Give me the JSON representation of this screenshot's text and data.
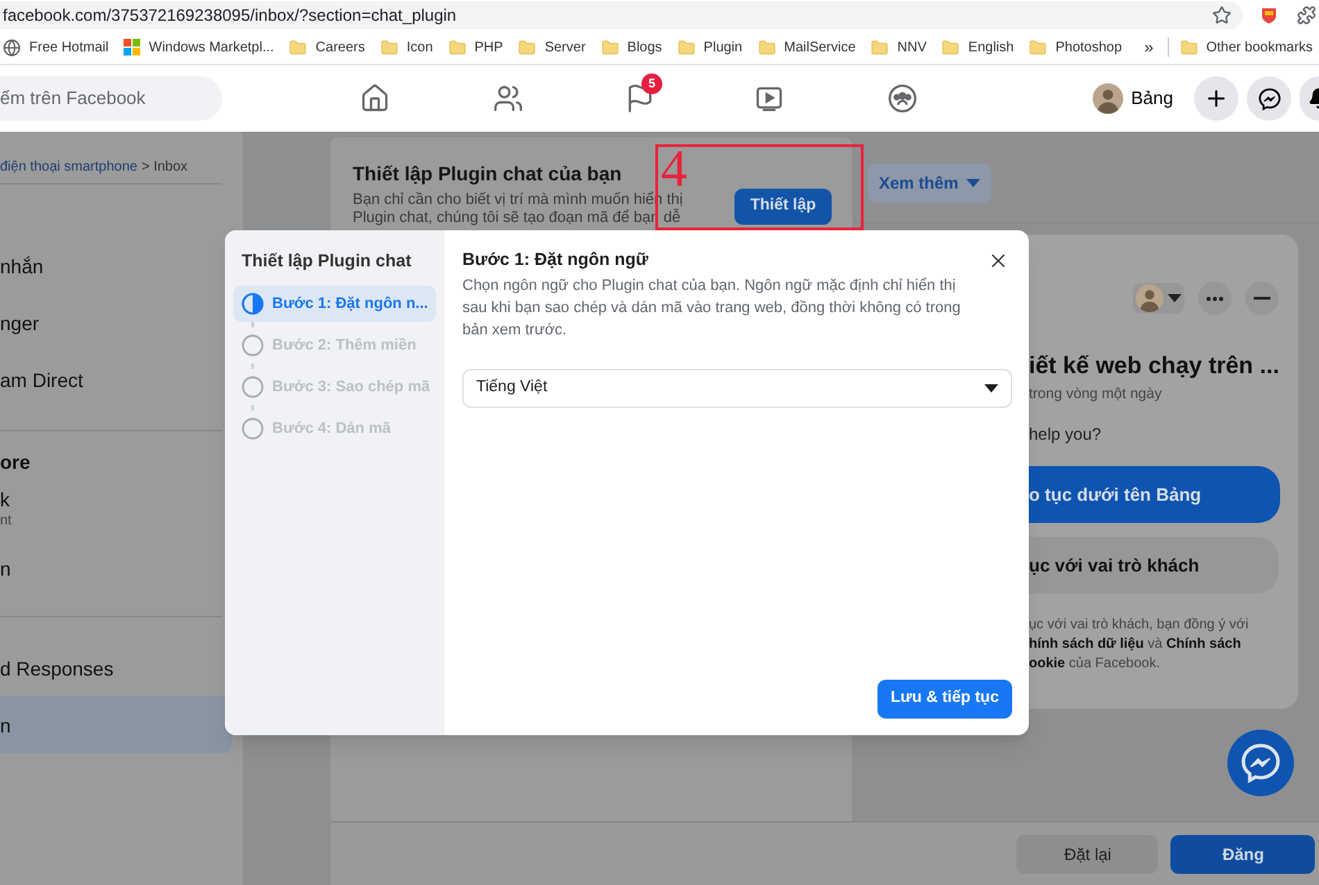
{
  "browser": {
    "url": "facebook.com/375372169238095/inbox/?section=chat_plugin",
    "bookmarks": [
      {
        "label": "Free Hotmail",
        "kind": "site"
      },
      {
        "label": "Windows Marketpl...",
        "kind": "windows"
      },
      {
        "label": "Careers",
        "kind": "folder"
      },
      {
        "label": "Icon",
        "kind": "folder"
      },
      {
        "label": "PHP",
        "kind": "folder"
      },
      {
        "label": "Server",
        "kind": "folder"
      },
      {
        "label": "Blogs",
        "kind": "folder"
      },
      {
        "label": "Plugin",
        "kind": "folder"
      },
      {
        "label": "MailService",
        "kind": "folder"
      },
      {
        "label": "NNV",
        "kind": "folder"
      },
      {
        "label": "English",
        "kind": "folder"
      },
      {
        "label": "Photoshop",
        "kind": "folder"
      }
    ],
    "overflow": "»",
    "other_bookmarks": "Other bookmarks"
  },
  "nav": {
    "search_placeholder": "ếm trên Facebook",
    "pages_badge": "5",
    "profile_name": "Bảng"
  },
  "breadcrumb": {
    "link": "điện thoại smartphone",
    "rest": "> Inbox"
  },
  "sidebar": {
    "groups": [
      {
        "items": [
          {
            "label": "nhắn",
            "selected": false
          },
          {
            "label": "nger",
            "selected": false
          },
          {
            "label": "am Direct",
            "selected": false
          }
        ]
      },
      {
        "heading": "ore",
        "items": [
          {
            "label": "k",
            "sublabel": "nt",
            "selected": false
          },
          {
            "label": "n",
            "selected": false
          }
        ]
      },
      {
        "items": [
          {
            "label": "d Responses",
            "selected": false
          },
          {
            "label": "n",
            "selected": true
          }
        ]
      }
    ]
  },
  "setup_card": {
    "title": "Thiết lập Plugin chat của bạn",
    "description": "Bạn chỉ cần cho biết vị trí mà mình muốn hiển thị Plugin chat, chúng tôi sẽ tạo đoạn mã để bạn dễ",
    "button": "Thiết lập"
  },
  "annotation": {
    "label": "4"
  },
  "more_button": "Xem thêm",
  "chat_preview": {
    "title": "iết kế web chạy trên ...",
    "subtitle": "trong vòng một ngày",
    "question": "help you?",
    "primary": "o tục dưới tên Bảng",
    "secondary": "ục với vai trò khách",
    "legal": [
      "ục với vai trò khách, bạn đồng ý với",
      "**hính sách dữ liệu** và **Chính sách**",
      "**ookie** của Facebook."
    ]
  },
  "footer": {
    "reset": "Đặt lại",
    "publish": "Đăng"
  },
  "modal": {
    "title": "Thiết lập Plugin chat",
    "steps": [
      {
        "label": "Bước 1: Đặt ngôn n...",
        "selected": true
      },
      {
        "label": "Bước 2: Thêm miền",
        "selected": false
      },
      {
        "label": "Bước 3: Sao chép mã",
        "selected": false
      },
      {
        "label": "Bước 4: Dán mã",
        "selected": false
      }
    ],
    "heading": "Bước 1: Đặt ngôn ngữ",
    "description": "Chọn ngôn ngữ cho Plugin chat của bạn. Ngôn ngữ mặc định chỉ hiển thị sau khi bạn sao chép và dán mã vào trang web, đồng thời không có trong bản xem trước.",
    "language": "Tiếng Việt",
    "save": "Lưu & tiếp tục"
  }
}
